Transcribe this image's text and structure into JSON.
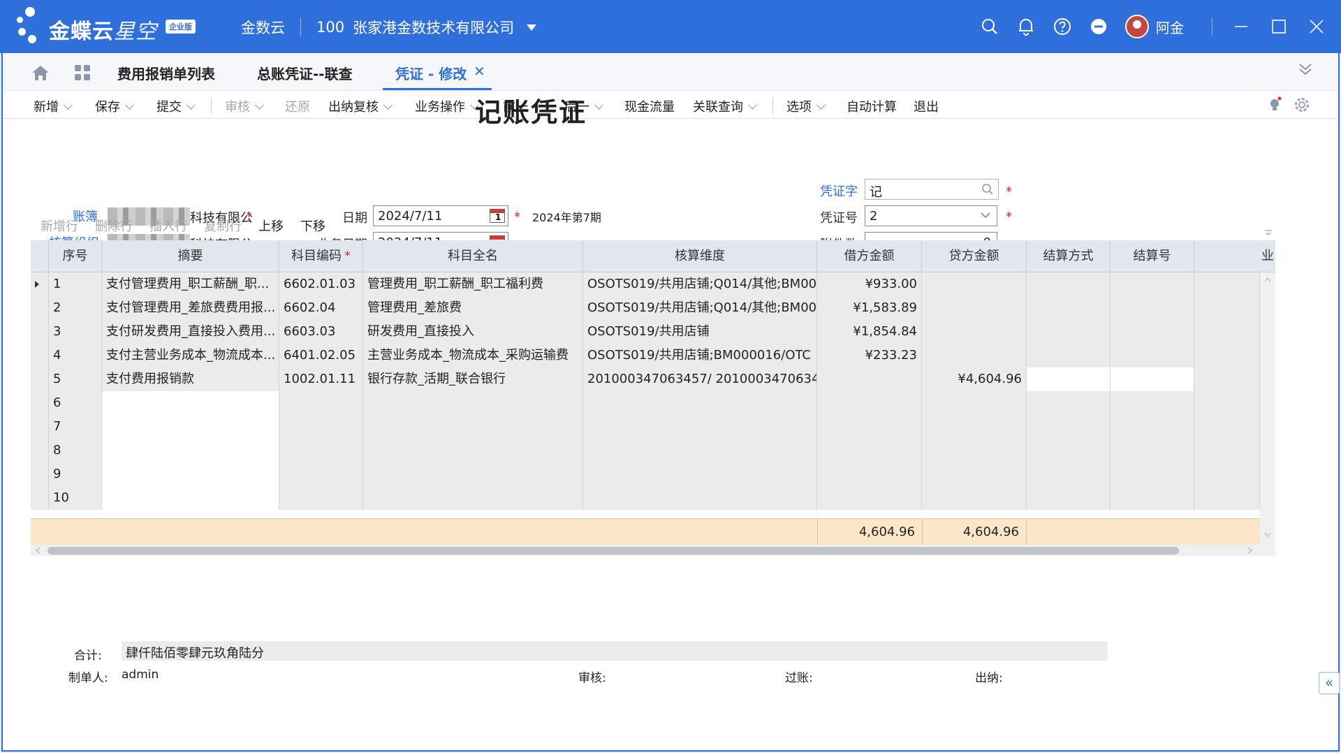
{
  "header": {
    "brand": "金蝶云",
    "brand_light": "星空",
    "badge": "企业版",
    "product": "金数云",
    "org_code": "100",
    "org_name": "张家港金数技术有限公司",
    "user": "阿金"
  },
  "tabs": {
    "items": [
      "费用报销单列表",
      "总账凭证--联查",
      "凭证 - 修改"
    ],
    "active": "凭证 - 修改"
  },
  "toolbar": {
    "new": "新增",
    "save": "保存",
    "submit": "提交",
    "audit": "审核",
    "restore": "还原",
    "cashier_review": "出纳复核",
    "business_ops": "业务操作",
    "prev": "前一",
    "next": "后一",
    "cash_flow": "现金流量",
    "linked_query": "关联查询",
    "options": "选项",
    "auto_calc": "自动计算",
    "exit": "退出"
  },
  "form": {
    "title": "记账凭证",
    "book_label": "账簿",
    "book_value": "科技有限公",
    "org_label": "核算组织",
    "org_value": "科技有限公",
    "date_label": "日期",
    "date_value": "2024/7/11",
    "biz_date_label": "业务日期",
    "biz_date_value": "2024/7/11",
    "period": "2024年第7期",
    "voucher_word_label": "凭证字",
    "voucher_word_value": "记",
    "voucher_no_label": "凭证号",
    "voucher_no_value": "2",
    "attachments_label": "附件数",
    "attachments_value": "0"
  },
  "grid_toolbar": {
    "add_row": "新增行",
    "delete_row": "删除行",
    "insert_row": "插入行",
    "copy_row": "复制行",
    "move_up": "上移",
    "move_down": "下移"
  },
  "grid": {
    "headers": [
      "序号",
      "摘要",
      "科目编码",
      "科目全名",
      "核算维度",
      "借方金额",
      "贷方金额",
      "结算方式",
      "结算号",
      "业"
    ],
    "rows": [
      {
        "no": "1",
        "summary": "支付管理费用_职工薪酬_职...",
        "code": "6602.01.03",
        "name": "管理费用_职工薪酬_职工福利费",
        "dimension": "OSOTS019/共用店铺;Q014/其他;BM000",
        "debit": "¥933.00",
        "credit": ""
      },
      {
        "no": "2",
        "summary": "支付管理费用_差旅费费用报...",
        "code": "6602.04",
        "name": "管理费用_差旅费",
        "dimension": "OSOTS019/共用店铺;Q014/其他;BM000",
        "debit": "¥1,583.89",
        "credit": ""
      },
      {
        "no": "3",
        "summary": "支付研发费用_直接投入费用...",
        "code": "6603.03",
        "name": "研发费用_直接投入",
        "dimension": "OSOTS019/共用店铺",
        "debit": "¥1,854.84",
        "credit": ""
      },
      {
        "no": "4",
        "summary": "支付主营业务成本_物流成本...",
        "code": "6401.02.05",
        "name": "主营业务成本_物流成本_采购运输费",
        "dimension": "OSOTS019/共用店铺;BM000016/OTC",
        "debit": "¥233.23",
        "credit": ""
      },
      {
        "no": "5",
        "summary": "支付费用报销款",
        "code": "1002.01.11",
        "name": "银行存款_活期_联合银行",
        "dimension": "201000347063457/ 2010003470634",
        "debit": "",
        "credit": "¥4,604.96"
      },
      {
        "no": "6",
        "summary": "",
        "code": "",
        "name": "",
        "dimension": "",
        "debit": "",
        "credit": ""
      },
      {
        "no": "7",
        "summary": "",
        "code": "",
        "name": "",
        "dimension": "",
        "debit": "",
        "credit": ""
      },
      {
        "no": "8",
        "summary": "",
        "code": "",
        "name": "",
        "dimension": "",
        "debit": "",
        "credit": ""
      },
      {
        "no": "9",
        "summary": "",
        "code": "",
        "name": "",
        "dimension": "",
        "debit": "",
        "credit": ""
      },
      {
        "no": "10",
        "summary": "",
        "code": "",
        "name": "",
        "dimension": "",
        "debit": "",
        "credit": ""
      }
    ],
    "total_debit": "4,604.96",
    "total_credit": "4,604.96"
  },
  "footer": {
    "total_label": "合计:",
    "total_words": "肆仟陆佰零肆元玖角陆分",
    "maker_label": "制单人:",
    "maker_value": "admin",
    "audit_label": "审核:",
    "posting_label": "过账:",
    "cashier_label": "出纳:"
  },
  "colors": {
    "header_blue": "#2f6fdb",
    "total_row": "#fbe7c8",
    "required": "#e0292d"
  }
}
